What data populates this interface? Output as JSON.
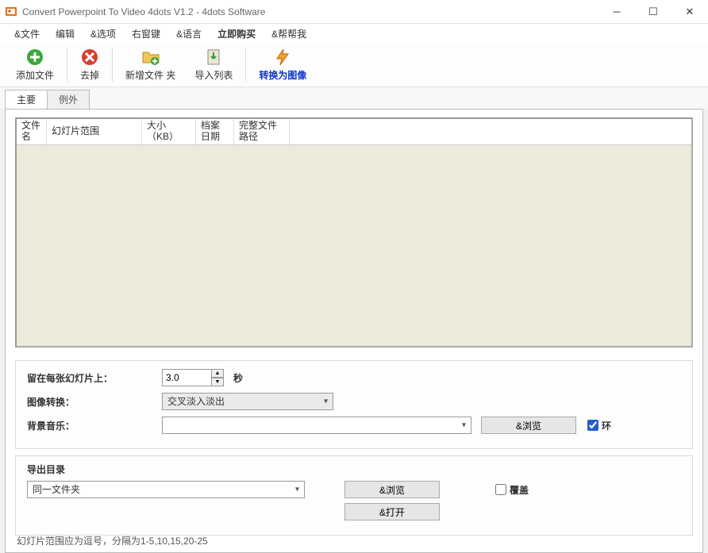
{
  "window": {
    "title": "Convert Powerpoint To Video 4dots V1.2 - 4dots Software"
  },
  "menu": {
    "file": "&文件",
    "edit": "编辑",
    "options": "&选项",
    "rightkey": "右窗键",
    "language": "&语言",
    "buy_now": "立即购买",
    "help": "&帮帮我"
  },
  "toolbar": {
    "add_file": "添加文件",
    "remove": "去掉",
    "new_folder": "新增文件 夹",
    "import_list": "导入列表",
    "convert_image": "转换为图像"
  },
  "tabs": {
    "main": "主要",
    "exception": "例外"
  },
  "table_headers": {
    "filename": "文件名",
    "slide_range": "幻灯片范围",
    "size": "大小（KB）",
    "date": "档案日期",
    "full_path": "完整文件路径"
  },
  "settings": {
    "stay_label": "留在每张幻灯片上：",
    "stay_value": "3.0",
    "stay_unit": "秒",
    "transition_label": "图像转换：",
    "transition_value": "交叉淡入淡出",
    "bg_music_label": "背景音乐：",
    "bg_music_value": "",
    "browse_label": "&浏览",
    "loop_label": "环"
  },
  "output": {
    "group_title": "导出目录",
    "same_folder": "同一文件夹",
    "browse_label": "&浏览",
    "open_label": "&打开",
    "overwrite_label": "覆盖"
  },
  "footer_hint": "幻灯片范围应为逗号，分隔为1-5,10,15,20-25"
}
